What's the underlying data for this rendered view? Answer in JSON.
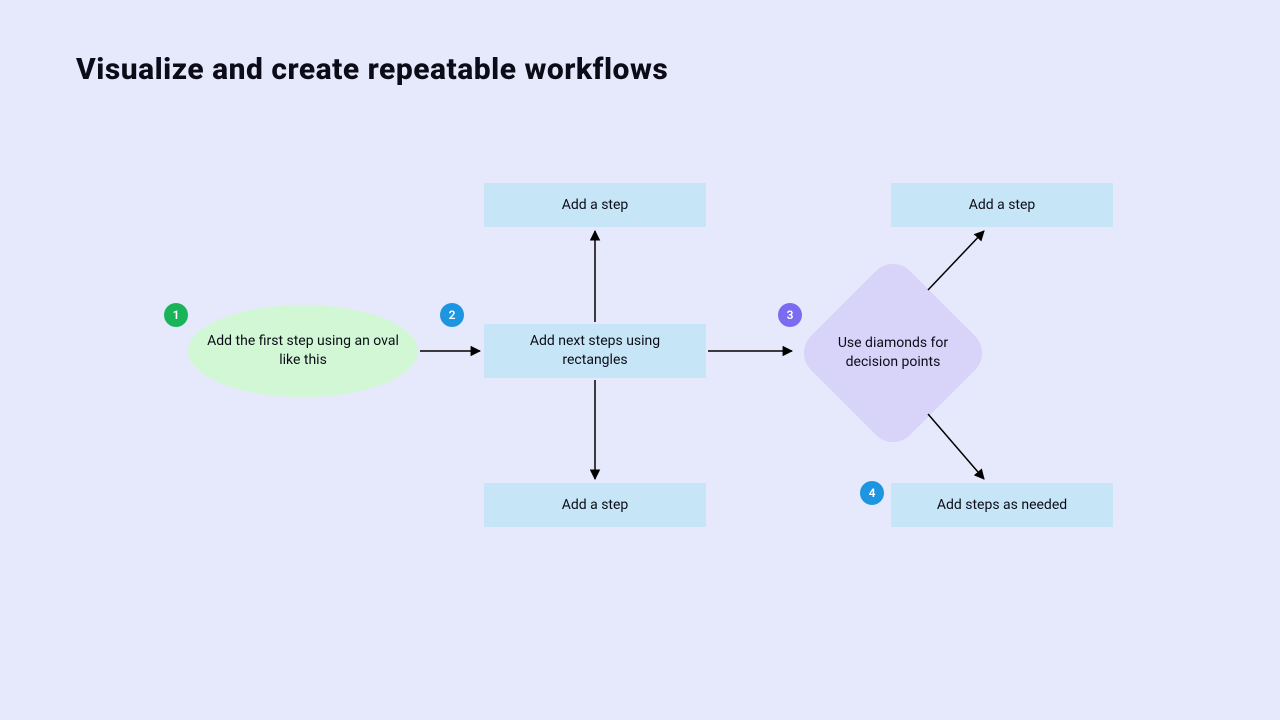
{
  "title": "Visualize and create repeatable workflows",
  "badges": {
    "b1": "1",
    "b2": "2",
    "b3": "3",
    "b4": "4"
  },
  "nodes": {
    "start": "Add the first step using an oval like this",
    "step_top": "Add a step",
    "step_center": "Add next steps using rectangles",
    "step_bottom": "Add a step",
    "decision": "Use diamonds for decision points",
    "out_top": "Add a step",
    "out_bottom": "Add steps as needed"
  }
}
